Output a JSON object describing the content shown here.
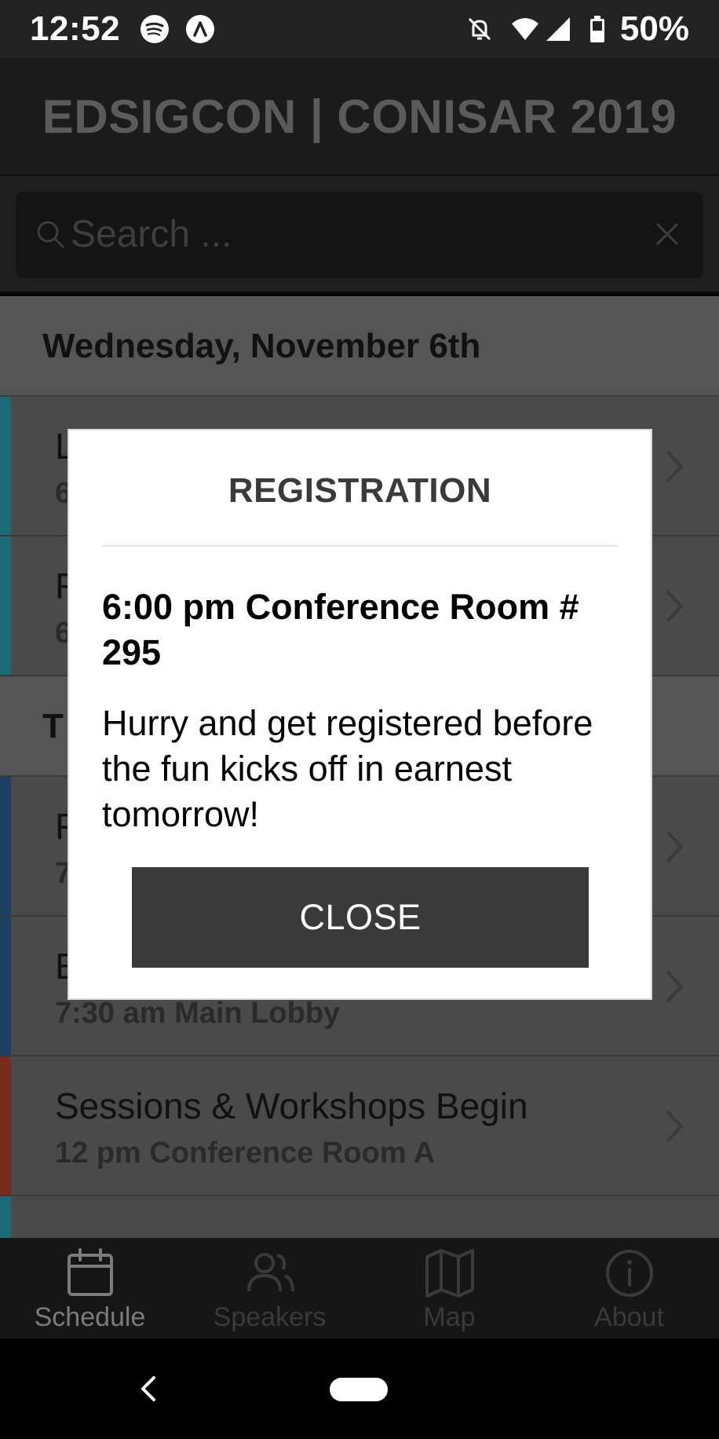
{
  "status_bar": {
    "time": "12:52",
    "battery": "50%",
    "icons": [
      "spotify-icon",
      "app-icon",
      "bell-off-icon",
      "wifi-icon",
      "signal-icon",
      "battery-icon"
    ]
  },
  "header": {
    "title": "EDSIGCON | CONISAR 2019"
  },
  "search": {
    "placeholder": "Search ..."
  },
  "schedule": {
    "day1": {
      "label": "Wednesday, November 6th",
      "sessions": [
        {
          "title": "L",
          "subtitle": "6",
          "track_color": "#1a6b75"
        },
        {
          "title": "R",
          "subtitle": "6",
          "track_color": "#1a6b75"
        }
      ]
    },
    "day2": {
      "label": "T",
      "sessions": [
        {
          "title": "F",
          "subtitle": "7",
          "track_color": "#1c3f66"
        },
        {
          "title": "E",
          "subtitle": "7:30 am Main Lobby",
          "track_color": "#1c3f66"
        },
        {
          "title": "Sessions & Workshops Begin",
          "subtitle": "12 pm Conference Room A",
          "track_color": "#7a2a1a"
        }
      ]
    }
  },
  "tabs": [
    {
      "label": "Schedule",
      "icon": "calendar-icon",
      "active": true
    },
    {
      "label": "Speakers",
      "icon": "people-icon",
      "active": false
    },
    {
      "label": "Map",
      "icon": "map-icon",
      "active": false
    },
    {
      "label": "About",
      "icon": "info-icon",
      "active": false
    }
  ],
  "dialog": {
    "title": "REGISTRATION",
    "subtitle": "6:00 pm Conference Room # 295",
    "message": "Hurry and get registered before the fun kicks off in earnest tomorrow!",
    "close_label": "CLOSE"
  }
}
